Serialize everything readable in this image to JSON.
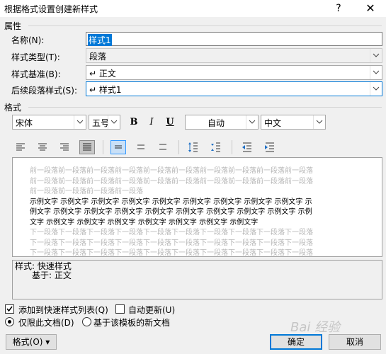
{
  "window": {
    "title": "根据格式设置创建新样式",
    "help": "?",
    "close": "✕"
  },
  "properties": {
    "section": "属性",
    "name_label": "名称(N):",
    "name_value": "样式1",
    "type_label": "样式类型(T):",
    "type_value": "段落",
    "based_label": "样式基准(B):",
    "based_value": "↵ 正文",
    "next_label": "后续段落样式(S):",
    "next_value": "↵ 样式1"
  },
  "format": {
    "section": "格式",
    "font": "宋体",
    "size": "五号",
    "bold": "B",
    "italic": "I",
    "underline": "U",
    "color": "自动",
    "language": "中文"
  },
  "preview": {
    "before": [
      "前一段落前一段落前一段落前一段落前一段落前一段落前一段落前一段落前一段落前一段落",
      "前一段落前一段落前一段落前一段落前一段落前一段落前一段落前一段落前一段落前一段落",
      "前一段落前一段落前一段落前一段落"
    ],
    "sample": [
      "示例文字 示例文字 示例文字 示例文字 示例文字 示例文字 示例文字 示例文字 示例文字 示",
      "例文字 示例文字 示例文字 示例文字 示例文字 示例文字 示例文字 示例文字 示例文字 示例",
      "文字 示例文字 示例文字 示例文字 示例文字 示例文字 示例文字 示例文字"
    ],
    "after": [
      "下一段落下一段落下一段落下一段落下一段落下一段落下一段落下一段落下一段落下一段落",
      "下一段落下一段落下一段落下一段落下一段落下一段落下一段落下一段落下一段落下一段落",
      "下一段落下一段落下一段落下一段落下一段落下一段落下一段落下一段落下一段落下一段落"
    ]
  },
  "description": {
    "line1": "样式: 快速样式",
    "line2": "基于: 正文"
  },
  "options": {
    "add_to_quick": "添加到快速样式列表(Q)",
    "auto_update": "自动更新(U)",
    "only_this_doc": "仅限此文档(D)",
    "new_docs_template": "基于该模板的新文档"
  },
  "buttons": {
    "format": "格式(O) ▾",
    "ok": "确定",
    "cancel": "取消"
  },
  "watermark": "Bai 经验"
}
